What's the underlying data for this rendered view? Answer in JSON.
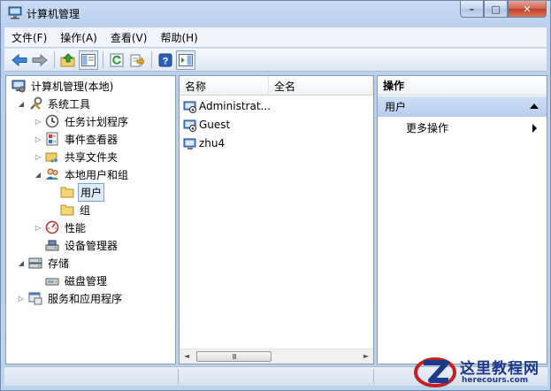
{
  "window": {
    "title": "计算机管理",
    "controls": {
      "minimize": "–",
      "maximize": "□",
      "close": "✕"
    }
  },
  "menubar": {
    "items": [
      {
        "label": "文件(F)"
      },
      {
        "label": "操作(A)"
      },
      {
        "label": "查看(V)"
      },
      {
        "label": "帮助(H)"
      }
    ]
  },
  "toolbar": {
    "buttons": [
      "back-icon",
      "forward-icon",
      "up-icon",
      "show-hide-tree-icon",
      "refresh-icon",
      "export-icon",
      "help-icon",
      "show-hide-action-icon"
    ]
  },
  "tree": {
    "items": [
      {
        "label": "计算机管理(本地)",
        "level": 0,
        "toggle": "",
        "icon": "computer-management-icon"
      },
      {
        "label": "系统工具",
        "level": 1,
        "toggle": "◢",
        "icon": "system-tools-icon"
      },
      {
        "label": "任务计划程序",
        "level": 2,
        "toggle": "▷",
        "icon": "task-scheduler-icon"
      },
      {
        "label": "事件查看器",
        "level": 2,
        "toggle": "▷",
        "icon": "event-viewer-icon"
      },
      {
        "label": "共享文件夹",
        "level": 2,
        "toggle": "▷",
        "icon": "shared-folders-icon"
      },
      {
        "label": "本地用户和组",
        "level": 2,
        "toggle": "◢",
        "icon": "local-users-groups-icon"
      },
      {
        "label": "用户",
        "level": 3,
        "toggle": "",
        "icon": "folder-icon",
        "selected": true
      },
      {
        "label": "组",
        "level": 3,
        "toggle": "",
        "icon": "folder-icon"
      },
      {
        "label": "性能",
        "level": 2,
        "toggle": "▷",
        "icon": "performance-icon"
      },
      {
        "label": "设备管理器",
        "level": 2,
        "toggle": "",
        "icon": "device-manager-icon"
      },
      {
        "label": "存储",
        "level": 1,
        "toggle": "◢",
        "icon": "storage-icon"
      },
      {
        "label": "磁盘管理",
        "level": 2,
        "toggle": "",
        "icon": "disk-management-icon"
      },
      {
        "label": "服务和应用程序",
        "level": 1,
        "toggle": "▷",
        "icon": "services-apps-icon"
      }
    ]
  },
  "list": {
    "columns": [
      "名称",
      "全名"
    ],
    "rows": [
      {
        "name": "Administrat...",
        "fullname": "",
        "icon": "disabled-user-icon"
      },
      {
        "name": "Guest",
        "fullname": "",
        "icon": "disabled-user-icon"
      },
      {
        "name": "zhu4",
        "fullname": "",
        "icon": "user-icon"
      }
    ],
    "scrollbar": {
      "left": "◄",
      "right": "►",
      "thumb": "III"
    }
  },
  "actions": {
    "header": "操作",
    "group_label": "用户",
    "items": [
      {
        "label": "更多操作"
      }
    ]
  },
  "watermark": {
    "title": "这里教程网",
    "url": "herecours.com"
  },
  "colors": {
    "frame": "#bcd3ee",
    "selection": "#dcecfc",
    "action_group": "#c4d8f2",
    "watermark": "#1d3a8a"
  }
}
